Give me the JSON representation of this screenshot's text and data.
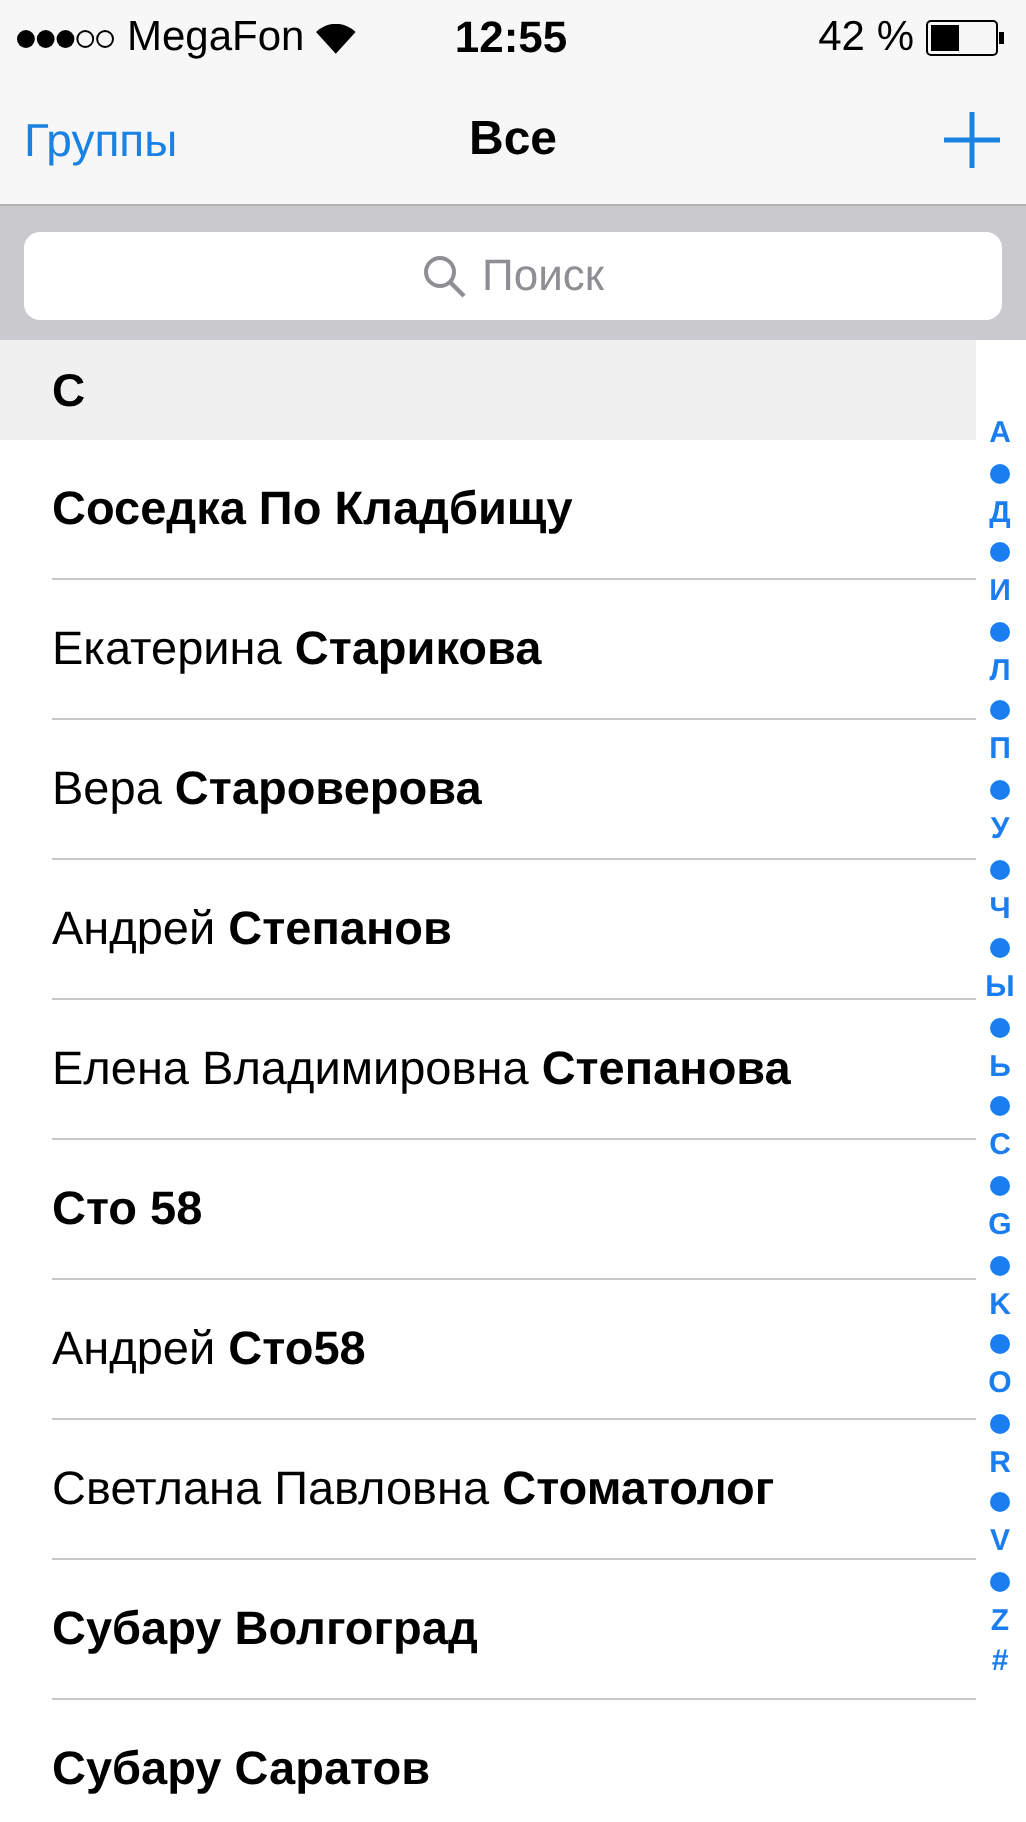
{
  "status_bar": {
    "carrier": "MegaFon",
    "time": "12:55",
    "battery": "42 %"
  },
  "nav": {
    "back": "Группы",
    "title": "Все"
  },
  "search": {
    "placeholder": "Поиск"
  },
  "section": {
    "header": "С",
    "contacts": [
      {
        "last": "Соседка По Кладбищу"
      },
      {
        "first": "Екатерина",
        "last": "Старикова"
      },
      {
        "first": "Вера",
        "last": "Староверова"
      },
      {
        "first": "Андрей",
        "last": "Степанов"
      },
      {
        "first": "Елена Владимировна",
        "last": "Степанова"
      },
      {
        "last": "Сто 58"
      },
      {
        "first": "Андрей",
        "last": "Сто58"
      },
      {
        "first": "Светлана Павловна",
        "last": "Стоматолог"
      },
      {
        "last": "Субару Волгоград"
      },
      {
        "last": "Субару Саратов"
      }
    ]
  },
  "index": [
    {
      "kind": "letter",
      "label": "А"
    },
    {
      "kind": "dot"
    },
    {
      "kind": "letter",
      "label": "Д"
    },
    {
      "kind": "dot"
    },
    {
      "kind": "letter",
      "label": "И"
    },
    {
      "kind": "dot"
    },
    {
      "kind": "letter",
      "label": "Л"
    },
    {
      "kind": "dot"
    },
    {
      "kind": "letter",
      "label": "П"
    },
    {
      "kind": "dot"
    },
    {
      "kind": "letter",
      "label": "У"
    },
    {
      "kind": "dot"
    },
    {
      "kind": "letter",
      "label": "Ч"
    },
    {
      "kind": "dot"
    },
    {
      "kind": "letter",
      "label": "Ы"
    },
    {
      "kind": "dot"
    },
    {
      "kind": "letter",
      "label": "Ь"
    },
    {
      "kind": "dot"
    },
    {
      "kind": "letter",
      "label": "C"
    },
    {
      "kind": "dot"
    },
    {
      "kind": "letter",
      "label": "G"
    },
    {
      "kind": "dot"
    },
    {
      "kind": "letter",
      "label": "K"
    },
    {
      "kind": "dot"
    },
    {
      "kind": "letter",
      "label": "O"
    },
    {
      "kind": "dot"
    },
    {
      "kind": "letter",
      "label": "R"
    },
    {
      "kind": "dot"
    },
    {
      "kind": "letter",
      "label": "V"
    },
    {
      "kind": "dot"
    },
    {
      "kind": "letter",
      "label": "Z"
    },
    {
      "kind": "letter",
      "label": "#"
    }
  ]
}
